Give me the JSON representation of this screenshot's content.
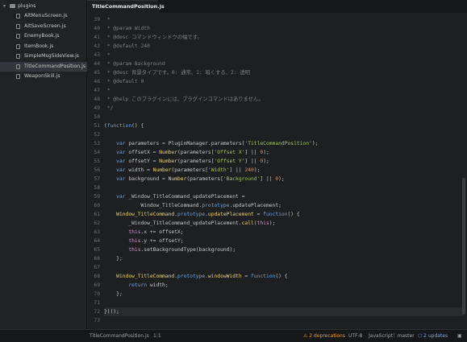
{
  "sidebar": {
    "root_folder": "plugins",
    "files": [
      {
        "name": "AltMenuScreen.js",
        "selected": false
      },
      {
        "name": "AltSaveScreen.js",
        "selected": false
      },
      {
        "name": "EnemyBook.js",
        "selected": false
      },
      {
        "name": "ItemBook.js",
        "selected": false
      },
      {
        "name": "SimpleMsgSideView.js",
        "selected": false
      },
      {
        "name": "TitleCommandPosition.js",
        "selected": true
      },
      {
        "name": "WeaponSkill.js",
        "selected": false
      }
    ]
  },
  "tab": {
    "title": "TitleCommandPosition.js",
    "close": "×"
  },
  "editor": {
    "current_line": 72,
    "lines": [
      {
        "n": "39",
        "t": [
          [
            "cm",
            " *"
          ]
        ]
      },
      {
        "n": "40",
        "t": [
          [
            "cm",
            " * @param Width"
          ]
        ]
      },
      {
        "n": "41",
        "t": [
          [
            "cm",
            " * @desc コマンドウィンドウの幅です。"
          ]
        ]
      },
      {
        "n": "42",
        "t": [
          [
            "cm",
            " * @default 240"
          ]
        ]
      },
      {
        "n": "43",
        "t": [
          [
            "cm",
            " *"
          ]
        ]
      },
      {
        "n": "44",
        "t": [
          [
            "cm",
            " * @param Background"
          ]
        ]
      },
      {
        "n": "45",
        "t": [
          [
            "cm",
            " * @desc 背景タイプです。0: 通常、1: 暗くする、2: 透明"
          ]
        ]
      },
      {
        "n": "46",
        "t": [
          [
            "cm",
            " * @default 0"
          ]
        ]
      },
      {
        "n": "47",
        "t": [
          [
            "cm",
            " *"
          ]
        ]
      },
      {
        "n": "48",
        "t": [
          [
            "cm",
            " * @help このプラグインには、プラグインコマンドはありません。"
          ]
        ]
      },
      {
        "n": "49",
        "t": [
          [
            "cm",
            " */"
          ]
        ]
      },
      {
        "n": "50",
        "t": []
      },
      {
        "n": "51",
        "t": [
          [
            "pl",
            "("
          ],
          [
            "kw",
            "function"
          ],
          [
            "pl",
            "() {"
          ]
        ]
      },
      {
        "n": "52",
        "t": []
      },
      {
        "n": "53",
        "t": [
          [
            "pl",
            "    "
          ],
          [
            "kw",
            "var"
          ],
          [
            "pl",
            " parameters = PluginManager.parameters("
          ],
          [
            "st",
            "'TitleCommandPosition'"
          ],
          [
            "pl",
            ");"
          ]
        ]
      },
      {
        "n": "54",
        "t": [
          [
            "pl",
            "    "
          ],
          [
            "kw",
            "var"
          ],
          [
            "pl",
            " offsetX = "
          ],
          [
            "fn",
            "Number"
          ],
          [
            "pl",
            "(parameters["
          ],
          [
            "st",
            "'Offset X'"
          ],
          [
            "pl",
            "] || "
          ],
          [
            "nm",
            "0"
          ],
          [
            "pl",
            ");"
          ]
        ]
      },
      {
        "n": "55",
        "t": [
          [
            "pl",
            "    "
          ],
          [
            "kw",
            "var"
          ],
          [
            "pl",
            " offsetY = "
          ],
          [
            "fn",
            "Number"
          ],
          [
            "pl",
            "(parameters["
          ],
          [
            "st",
            "'Offset Y'"
          ],
          [
            "pl",
            "] || "
          ],
          [
            "nm",
            "0"
          ],
          [
            "pl",
            ");"
          ]
        ]
      },
      {
        "n": "56",
        "t": [
          [
            "pl",
            "    "
          ],
          [
            "kw",
            "var"
          ],
          [
            "pl",
            " width = "
          ],
          [
            "fn",
            "Number"
          ],
          [
            "pl",
            "(parameters["
          ],
          [
            "st",
            "'Width'"
          ],
          [
            "pl",
            "] || "
          ],
          [
            "nm",
            "240"
          ],
          [
            "pl",
            ");"
          ]
        ]
      },
      {
        "n": "57",
        "t": [
          [
            "pl",
            "    "
          ],
          [
            "kw",
            "var"
          ],
          [
            "pl",
            " background = "
          ],
          [
            "fn",
            "Number"
          ],
          [
            "pl",
            "(parameters["
          ],
          [
            "st",
            "'Background'"
          ],
          [
            "pl",
            "] || "
          ],
          [
            "nm",
            "0"
          ],
          [
            "pl",
            ");"
          ]
        ]
      },
      {
        "n": "58",
        "t": []
      },
      {
        "n": "59",
        "t": [
          [
            "pl",
            "    "
          ],
          [
            "kw",
            "var"
          ],
          [
            "pl",
            " _Window_TitleCommand_updatePlacement ="
          ]
        ]
      },
      {
        "n": "60",
        "t": [
          [
            "pl",
            "            Window_TitleCommand."
          ],
          [
            "kw",
            "prototype"
          ],
          [
            "pl",
            ".updatePlacement;"
          ]
        ]
      },
      {
        "n": "61",
        "t": [
          [
            "pl",
            "    "
          ],
          [
            "fn",
            "Window_TitleCommand"
          ],
          [
            "pl",
            "."
          ],
          [
            "kw",
            "prototype"
          ],
          [
            "pl",
            "."
          ],
          [
            "fn",
            "updatePlacement"
          ],
          [
            "pl",
            " = "
          ],
          [
            "kw",
            "function"
          ],
          [
            "pl",
            "() {"
          ]
        ]
      },
      {
        "n": "62",
        "t": [
          [
            "pl",
            "        _Window_TitleCommand_updatePlacement."
          ],
          [
            "fn",
            "call"
          ],
          [
            "pl",
            "("
          ],
          [
            "th",
            "this"
          ],
          [
            "pl",
            ");"
          ]
        ]
      },
      {
        "n": "63",
        "t": [
          [
            "pl",
            "        "
          ],
          [
            "th",
            "this"
          ],
          [
            "pl",
            ".x += offsetX;"
          ]
        ]
      },
      {
        "n": "64",
        "t": [
          [
            "pl",
            "        "
          ],
          [
            "th",
            "this"
          ],
          [
            "pl",
            ".y += offsetY;"
          ]
        ]
      },
      {
        "n": "65",
        "t": [
          [
            "pl",
            "        "
          ],
          [
            "th",
            "this"
          ],
          [
            "pl",
            ".setBackgroundType(background);"
          ]
        ]
      },
      {
        "n": "66",
        "t": [
          [
            "pl",
            "    };"
          ]
        ]
      },
      {
        "n": "67",
        "t": []
      },
      {
        "n": "68",
        "t": [
          [
            "pl",
            "    "
          ],
          [
            "fn",
            "Window_TitleCommand"
          ],
          [
            "pl",
            "."
          ],
          [
            "kw",
            "prototype"
          ],
          [
            "pl",
            "."
          ],
          [
            "fn",
            "windowWidth"
          ],
          [
            "pl",
            " = "
          ],
          [
            "kw",
            "function"
          ],
          [
            "pl",
            "() {"
          ]
        ]
      },
      {
        "n": "69",
        "t": [
          [
            "pl",
            "        "
          ],
          [
            "kw",
            "return"
          ],
          [
            "pl",
            " width;"
          ]
        ]
      },
      {
        "n": "70",
        "t": [
          [
            "pl",
            "    };"
          ]
        ]
      },
      {
        "n": "71",
        "t": []
      },
      {
        "n": "72",
        "t": [
          [
            "pl",
            "})();"
          ]
        ]
      },
      {
        "n": "73",
        "t": []
      }
    ]
  },
  "status": {
    "file": "TitleCommandPosition.js",
    "cursor": "1:1",
    "warnings": "2 deprecations",
    "encoding": "UTF-8",
    "grammar": "JavaScript",
    "branch": "master",
    "updates": "2 updates"
  }
}
